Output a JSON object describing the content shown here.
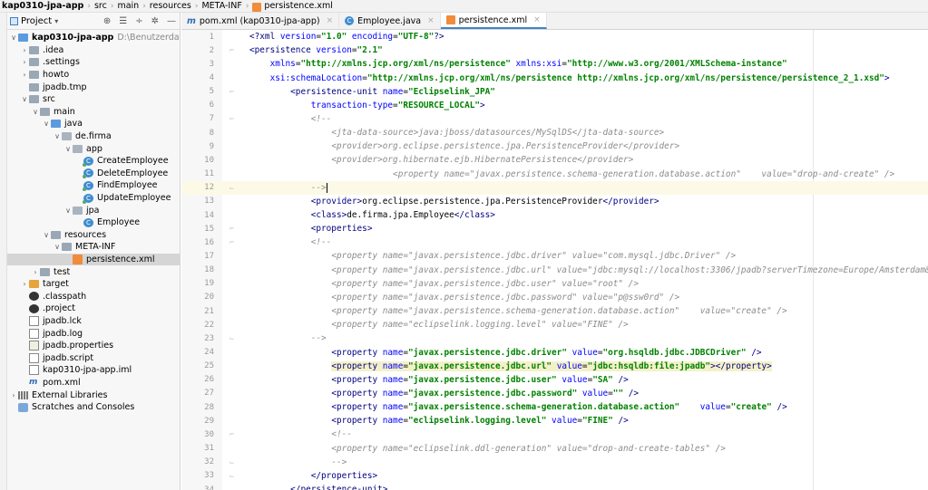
{
  "breadcrumb": [
    "kap0310-jpa-app",
    "src",
    "main",
    "resources",
    "META-INF",
    "persistence.xml"
  ],
  "project_panel": {
    "title": "Project",
    "tree": [
      {
        "label": "kap0310-jpa-app",
        "path": "D:\\Benutzerdaten\\Merten",
        "depth": 0,
        "arrow": "open",
        "icon": "module",
        "bold": true
      },
      {
        "label": ".idea",
        "depth": 1,
        "arrow": "closed",
        "icon": "folder"
      },
      {
        "label": ".settings",
        "depth": 1,
        "arrow": "closed",
        "icon": "folder"
      },
      {
        "label": "howto",
        "depth": 1,
        "arrow": "closed",
        "icon": "folder"
      },
      {
        "label": "jpadb.tmp",
        "depth": 1,
        "arrow": "none",
        "icon": "folder"
      },
      {
        "label": "src",
        "depth": 1,
        "arrow": "open",
        "icon": "folder-src"
      },
      {
        "label": "main",
        "depth": 2,
        "arrow": "open",
        "icon": "folder"
      },
      {
        "label": "java",
        "depth": 3,
        "arrow": "open",
        "icon": "folder-blue"
      },
      {
        "label": "de.firma",
        "depth": 4,
        "arrow": "open",
        "icon": "package"
      },
      {
        "label": "app",
        "depth": 5,
        "arrow": "open",
        "icon": "package"
      },
      {
        "label": "CreateEmployee",
        "depth": 6,
        "arrow": "none",
        "icon": "class-run"
      },
      {
        "label": "DeleteEmployee",
        "depth": 6,
        "arrow": "none",
        "icon": "class-run"
      },
      {
        "label": "FindEmployee",
        "depth": 6,
        "arrow": "none",
        "icon": "class-run"
      },
      {
        "label": "UpdateEmployee",
        "depth": 6,
        "arrow": "none",
        "icon": "class-run"
      },
      {
        "label": "jpa",
        "depth": 5,
        "arrow": "open",
        "icon": "package"
      },
      {
        "label": "Employee",
        "depth": 6,
        "arrow": "none",
        "icon": "class"
      },
      {
        "label": "resources",
        "depth": 3,
        "arrow": "open",
        "icon": "folder-res"
      },
      {
        "label": "META-INF",
        "depth": 4,
        "arrow": "open",
        "icon": "folder"
      },
      {
        "label": "persistence.xml",
        "depth": 5,
        "arrow": "none",
        "icon": "xml",
        "selected": true
      },
      {
        "label": "test",
        "depth": 2,
        "arrow": "closed",
        "icon": "folder"
      },
      {
        "label": "target",
        "depth": 1,
        "arrow": "closed",
        "icon": "folder-orange"
      },
      {
        "label": ".classpath",
        "depth": 1,
        "arrow": "none",
        "icon": "dot"
      },
      {
        "label": ".project",
        "depth": 1,
        "arrow": "none",
        "icon": "dot"
      },
      {
        "label": "jpadb.lck",
        "depth": 1,
        "arrow": "none",
        "icon": "file"
      },
      {
        "label": "jpadb.log",
        "depth": 1,
        "arrow": "none",
        "icon": "file"
      },
      {
        "label": "jpadb.properties",
        "depth": 1,
        "arrow": "none",
        "icon": "props"
      },
      {
        "label": "jpadb.script",
        "depth": 1,
        "arrow": "none",
        "icon": "file"
      },
      {
        "label": "kap0310-jpa-app.iml",
        "depth": 1,
        "arrow": "none",
        "icon": "file"
      },
      {
        "label": "pom.xml",
        "depth": 1,
        "arrow": "none",
        "icon": "maven"
      },
      {
        "label": "External Libraries",
        "depth": 0,
        "arrow": "closed",
        "icon": "libs"
      },
      {
        "label": "Scratches and Consoles",
        "depth": 0,
        "arrow": "none",
        "icon": "scratch"
      }
    ]
  },
  "tabs": [
    {
      "label": "pom.xml (kap0310-jpa-app)",
      "icon": "maven",
      "active": false
    },
    {
      "label": "Employee.java",
      "icon": "class",
      "active": false
    },
    {
      "label": "persistence.xml",
      "icon": "xml",
      "active": true
    }
  ],
  "editor": {
    "caret_line": 12,
    "highlight_line": 25,
    "lines": [
      {
        "n": "1",
        "fold": "",
        "tokens": [
          [
            "pi",
            "<?xml "
          ],
          [
            "attr",
            "version"
          ],
          [
            "t",
            "="
          ],
          [
            "val",
            "\"1.0\" "
          ],
          [
            "attr",
            "encoding"
          ],
          [
            "t",
            "="
          ],
          [
            "val",
            "\"UTF-8\""
          ],
          [
            "pi",
            "?>"
          ]
        ]
      },
      {
        "n": "2",
        "fold": "⌐",
        "tokens": [
          [
            "tag",
            "<persistence "
          ],
          [
            "attr",
            "version"
          ],
          [
            "t",
            "="
          ],
          [
            "val",
            "\"2.1\""
          ]
        ]
      },
      {
        "n": "3",
        "fold": "",
        "tokens": [
          [
            "t",
            "    "
          ],
          [
            "attr",
            "xmlns"
          ],
          [
            "t",
            "="
          ],
          [
            "val",
            "\"http://xmlns.jcp.org/xml/ns/persistence\" "
          ],
          [
            "attr",
            "xmlns:xsi"
          ],
          [
            "t",
            "="
          ],
          [
            "val",
            "\"http://www.w3.org/2001/XMLSchema-instance\""
          ]
        ]
      },
      {
        "n": "4",
        "fold": "",
        "tokens": [
          [
            "t",
            "    "
          ],
          [
            "attr",
            "xsi:schemaLocation"
          ],
          [
            "t",
            "="
          ],
          [
            "val",
            "\"http://xmlns.jcp.org/xml/ns/persistence http://xmlns.jcp.org/xml/ns/persistence/persistence_2_1.xsd\""
          ],
          [
            "tag",
            ">"
          ]
        ]
      },
      {
        "n": "5",
        "fold": "⌐",
        "tokens": [
          [
            "t",
            "        "
          ],
          [
            "tag",
            "<persistence-unit "
          ],
          [
            "attr",
            "name"
          ],
          [
            "t",
            "="
          ],
          [
            "val",
            "\"Eclipselink_JPA\""
          ]
        ]
      },
      {
        "n": "6",
        "fold": "",
        "tokens": [
          [
            "t",
            "            "
          ],
          [
            "attr",
            "transaction-type"
          ],
          [
            "t",
            "="
          ],
          [
            "val",
            "\"RESOURCE_LOCAL\""
          ],
          [
            "tag",
            ">"
          ]
        ]
      },
      {
        "n": "7",
        "fold": "⌐",
        "tokens": [
          [
            "t",
            "            "
          ],
          [
            "c",
            "<!--"
          ]
        ]
      },
      {
        "n": "8",
        "fold": "",
        "tokens": [
          [
            "t",
            "                "
          ],
          [
            "c",
            "<jta-data-source>java:jboss/datasources/MySqlDS</jta-data-source>"
          ]
        ]
      },
      {
        "n": "9",
        "fold": "",
        "tokens": [
          [
            "t",
            "                "
          ],
          [
            "c",
            "<provider>org.eclipse.persistence.jpa.PersistenceProvider</provider>"
          ]
        ]
      },
      {
        "n": "10",
        "fold": "",
        "tokens": [
          [
            "t",
            "                "
          ],
          [
            "c",
            "<provider>org.hibernate.ejb.HibernatePersistence</provider>"
          ]
        ]
      },
      {
        "n": "11",
        "fold": "",
        "tokens": [
          [
            "t",
            "                            "
          ],
          [
            "c",
            "<property name=\"javax.persistence.schema-generation.database.action\"    value=\"drop-and-create\" />"
          ]
        ]
      },
      {
        "n": "12",
        "fold": "⌙",
        "tokens": [
          [
            "t",
            "            "
          ],
          [
            "c",
            "-->"
          ]
        ]
      },
      {
        "n": "13",
        "fold": "",
        "tokens": [
          [
            "t",
            "            "
          ],
          [
            "tag",
            "<provider>"
          ],
          [
            "t",
            "org.eclipse.persistence.jpa.PersistenceProvider"
          ],
          [
            "tag",
            "</provider>"
          ]
        ]
      },
      {
        "n": "14",
        "fold": "",
        "tokens": [
          [
            "t",
            "            "
          ],
          [
            "tag",
            "<class>"
          ],
          [
            "t",
            "de.firma.jpa.Employee"
          ],
          [
            "tag",
            "</class>"
          ]
        ]
      },
      {
        "n": "15",
        "fold": "⌐",
        "tokens": [
          [
            "t",
            "            "
          ],
          [
            "tag",
            "<properties>"
          ]
        ]
      },
      {
        "n": "16",
        "fold": "⌐",
        "tokens": [
          [
            "t",
            "            "
          ],
          [
            "c",
            "<!--"
          ]
        ]
      },
      {
        "n": "17",
        "fold": "",
        "tokens": [
          [
            "t",
            "                "
          ],
          [
            "c",
            "<property name=\"javax.persistence.jdbc.driver\" value=\"com.mysql.jdbc.Driver\" />"
          ]
        ]
      },
      {
        "n": "18",
        "fold": "",
        "tokens": [
          [
            "t",
            "                "
          ],
          [
            "c",
            "<property name=\"javax.persistence.jdbc.url\" value=\"jdbc:mysql://localhost:3306/jpadb?serverTimezone=Europe/Amsterdam&useSSL=false\""
          ]
        ]
      },
      {
        "n": "19",
        "fold": "",
        "tokens": [
          [
            "t",
            "                "
          ],
          [
            "c",
            "<property name=\"javax.persistence.jdbc.user\" value=\"root\" />"
          ]
        ]
      },
      {
        "n": "20",
        "fold": "",
        "tokens": [
          [
            "t",
            "                "
          ],
          [
            "c",
            "<property name=\"javax.persistence.jdbc.password\" value=\"p@ssw0rd\" />"
          ]
        ]
      },
      {
        "n": "21",
        "fold": "",
        "tokens": [
          [
            "t",
            "                "
          ],
          [
            "c",
            "<property name=\"javax.persistence.schema-generation.database.action\"    value=\"create\" />"
          ]
        ]
      },
      {
        "n": "22",
        "fold": "",
        "tokens": [
          [
            "t",
            "                "
          ],
          [
            "c",
            "<property name=\"eclipselink.logging.level\" value=\"FINE\" />"
          ]
        ]
      },
      {
        "n": "23",
        "fold": "⌙",
        "tokens": [
          [
            "t",
            "            "
          ],
          [
            "c",
            "-->"
          ]
        ]
      },
      {
        "n": "24",
        "fold": "",
        "tokens": [
          [
            "t",
            "                "
          ],
          [
            "tag",
            "<property "
          ],
          [
            "attr",
            "name"
          ],
          [
            "t",
            "="
          ],
          [
            "val",
            "\"javax.persistence.jdbc.driver\" "
          ],
          [
            "attr",
            "value"
          ],
          [
            "t",
            "="
          ],
          [
            "val",
            "\"org.hsqldb.jdbc.JDBCDriver\" "
          ],
          [
            "tag",
            "/>"
          ]
        ]
      },
      {
        "n": "25",
        "fold": "",
        "tokens": [
          [
            "t",
            "                "
          ],
          [
            "tag",
            "<property "
          ],
          [
            "attr",
            "name"
          ],
          [
            "t",
            "="
          ],
          [
            "val",
            "\"javax.persistence.jdbc.url\" "
          ],
          [
            "attr",
            "value"
          ],
          [
            "t",
            "="
          ],
          [
            "val",
            "\"jdbc:hsqldb:file:jpadb\""
          ],
          [
            "tag",
            "></property>"
          ]
        ]
      },
      {
        "n": "26",
        "fold": "",
        "tokens": [
          [
            "t",
            "                "
          ],
          [
            "tag",
            "<property "
          ],
          [
            "attr",
            "name"
          ],
          [
            "t",
            "="
          ],
          [
            "val",
            "\"javax.persistence.jdbc.user\" "
          ],
          [
            "attr",
            "value"
          ],
          [
            "t",
            "="
          ],
          [
            "val",
            "\"SA\" "
          ],
          [
            "tag",
            "/>"
          ]
        ]
      },
      {
        "n": "27",
        "fold": "",
        "tokens": [
          [
            "t",
            "                "
          ],
          [
            "tag",
            "<property "
          ],
          [
            "attr",
            "name"
          ],
          [
            "t",
            "="
          ],
          [
            "val",
            "\"javax.persistence.jdbc.password\" "
          ],
          [
            "attr",
            "value"
          ],
          [
            "t",
            "="
          ],
          [
            "val",
            "\"\" "
          ],
          [
            "tag",
            "/>"
          ]
        ]
      },
      {
        "n": "28",
        "fold": "",
        "tokens": [
          [
            "t",
            "                "
          ],
          [
            "tag",
            "<property "
          ],
          [
            "attr",
            "name"
          ],
          [
            "t",
            "="
          ],
          [
            "val",
            "\"javax.persistence.schema-generation.database.action\"    "
          ],
          [
            "attr",
            "value"
          ],
          [
            "t",
            "="
          ],
          [
            "val",
            "\"create\" "
          ],
          [
            "tag",
            "/>"
          ]
        ]
      },
      {
        "n": "29",
        "fold": "",
        "tokens": [
          [
            "t",
            "                "
          ],
          [
            "tag",
            "<property "
          ],
          [
            "attr",
            "name"
          ],
          [
            "t",
            "="
          ],
          [
            "val",
            "\"eclipselink.logging.level\" "
          ],
          [
            "attr",
            "value"
          ],
          [
            "t",
            "="
          ],
          [
            "val",
            "\"FINE\" "
          ],
          [
            "tag",
            "/>"
          ]
        ]
      },
      {
        "n": "30",
        "fold": "⌐",
        "tokens": [
          [
            "t",
            "                "
          ],
          [
            "c",
            "<!--"
          ]
        ]
      },
      {
        "n": "31",
        "fold": "",
        "tokens": [
          [
            "t",
            "                "
          ],
          [
            "c",
            "<property name=\"eclipselink.ddl-generation\" value=\"drop-and-create-tables\" />"
          ]
        ]
      },
      {
        "n": "32",
        "fold": "⌙",
        "tokens": [
          [
            "t",
            "                "
          ],
          [
            "c",
            "-->"
          ]
        ]
      },
      {
        "n": "33",
        "fold": "⌙",
        "tokens": [
          [
            "t",
            "            "
          ],
          [
            "tag",
            "</properties>"
          ]
        ]
      },
      {
        "n": "34",
        "fold": "",
        "tokens": [
          [
            "t",
            "        "
          ],
          [
            "tag",
            "</persistence-unit>"
          ]
        ]
      }
    ]
  },
  "colors": {
    "tag": "#000080",
    "attribute": "#0000ff",
    "value": "#008000",
    "comment": "#8c8c8c",
    "active_tab_underline": "#4083c9",
    "selection": "#d5d5d5"
  }
}
